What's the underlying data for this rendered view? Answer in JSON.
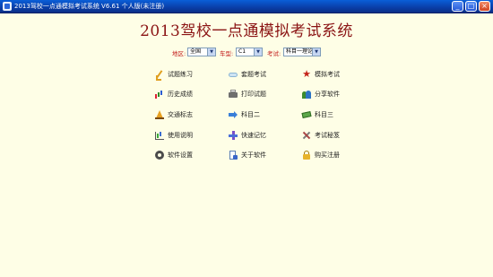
{
  "window": {
    "title": "2013驾校一点通模拟考试系统 V6.61 个人版(未注册)",
    "buttons": {
      "minimize": "_",
      "maximize": "□",
      "close": "×"
    }
  },
  "main_title": "2013驾校一点通模拟考试系统",
  "filters": {
    "region": {
      "label": "地区:",
      "value": "全国"
    },
    "car_type": {
      "label": "车型:",
      "value": "C1"
    },
    "exam": {
      "label": "考试:",
      "value": "科目一理论"
    }
  },
  "menu": [
    {
      "label": "试题练习",
      "icon": "pencil-icon"
    },
    {
      "label": "套题考试",
      "icon": "cloud-icon"
    },
    {
      "label": "模拟考试",
      "icon": "star-icon"
    },
    {
      "label": "历史成绩",
      "icon": "bar-chart-icon"
    },
    {
      "label": "打印试题",
      "icon": "printer-icon"
    },
    {
      "label": "分享软件",
      "icon": "people-icon"
    },
    {
      "label": "交通标志",
      "icon": "traffic-cone-icon"
    },
    {
      "label": "科目二",
      "icon": "arrow-icon"
    },
    {
      "label": "科目三",
      "icon": "money-icon"
    },
    {
      "label": "使用说明",
      "icon": "chart-icon"
    },
    {
      "label": "快速记忆",
      "icon": "cross-icon"
    },
    {
      "label": "考试秘笈",
      "icon": "tools-icon"
    },
    {
      "label": "软件设置",
      "icon": "gear-icon"
    },
    {
      "label": "关于软件",
      "icon": "document-icon"
    },
    {
      "label": "购买注册",
      "icon": "lock-icon"
    }
  ]
}
